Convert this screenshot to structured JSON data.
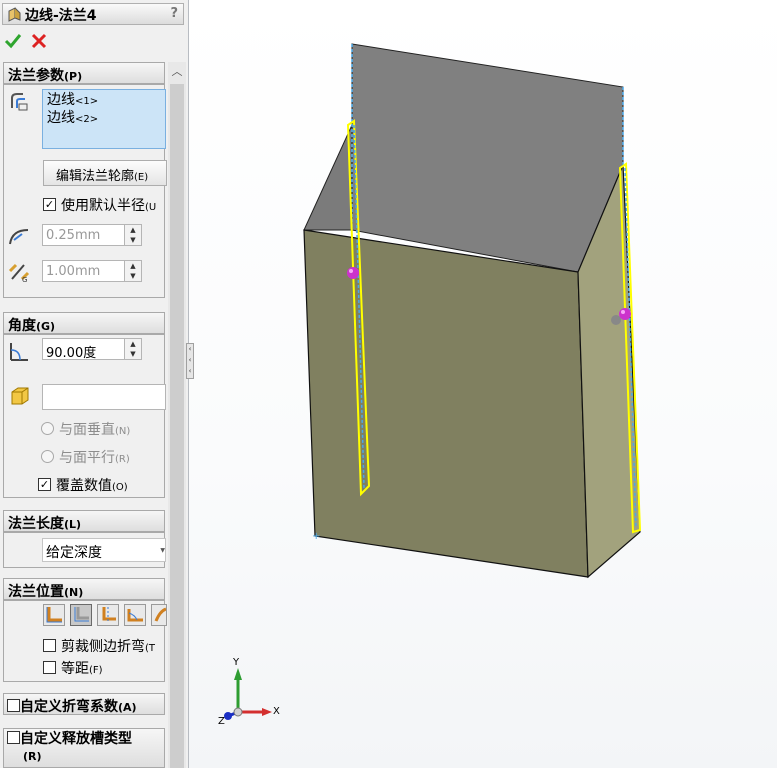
{
  "title": "边线-法兰4",
  "help": "?",
  "params": {
    "header": "法兰参数",
    "header_key": "(P)",
    "edges": [
      "边线",
      "边线"
    ],
    "edge_tags": [
      "<1>",
      "<2>"
    ],
    "edit_profile": "编辑法兰轮廓",
    "edit_profile_key": "(E)",
    "use_default_radius": "使用默认半径",
    "use_default_radius_key": "(U",
    "radius": "0.25mm",
    "gap": "1.00mm"
  },
  "angle": {
    "header": "角度",
    "header_key": "(G)",
    "value": "90.00度",
    "perpendicular": "与面垂直",
    "perpendicular_key": "(N)",
    "parallel": "与面平行",
    "parallel_key": "(R)",
    "override": "覆盖数值",
    "override_key": "(O)"
  },
  "length": {
    "header": "法兰长度",
    "header_key": "(L)",
    "selected": "给定深度"
  },
  "position": {
    "header": "法兰位置",
    "header_key": "(N)",
    "trim": "剪裁侧边折弯",
    "trim_key": "(T",
    "offset": "等距",
    "offset_key": "(F)"
  },
  "custom_bend": {
    "label": "自定义折弯系数",
    "key": "(A)"
  },
  "custom_relief": {
    "label": "自定义释放槽类型",
    "key": "(R)"
  },
  "triad": {
    "x": "X",
    "y": "Y",
    "z": "Z"
  },
  "colors": {
    "panel_bg": "#f0f0f0",
    "selection_blue": "#cce4f7",
    "model_front": "#808060",
    "model_side": "#a2a27d",
    "flange_gray": "#808080",
    "highlight_yellow": "#ffff00",
    "handle_magenta": "#cc33cc"
  }
}
